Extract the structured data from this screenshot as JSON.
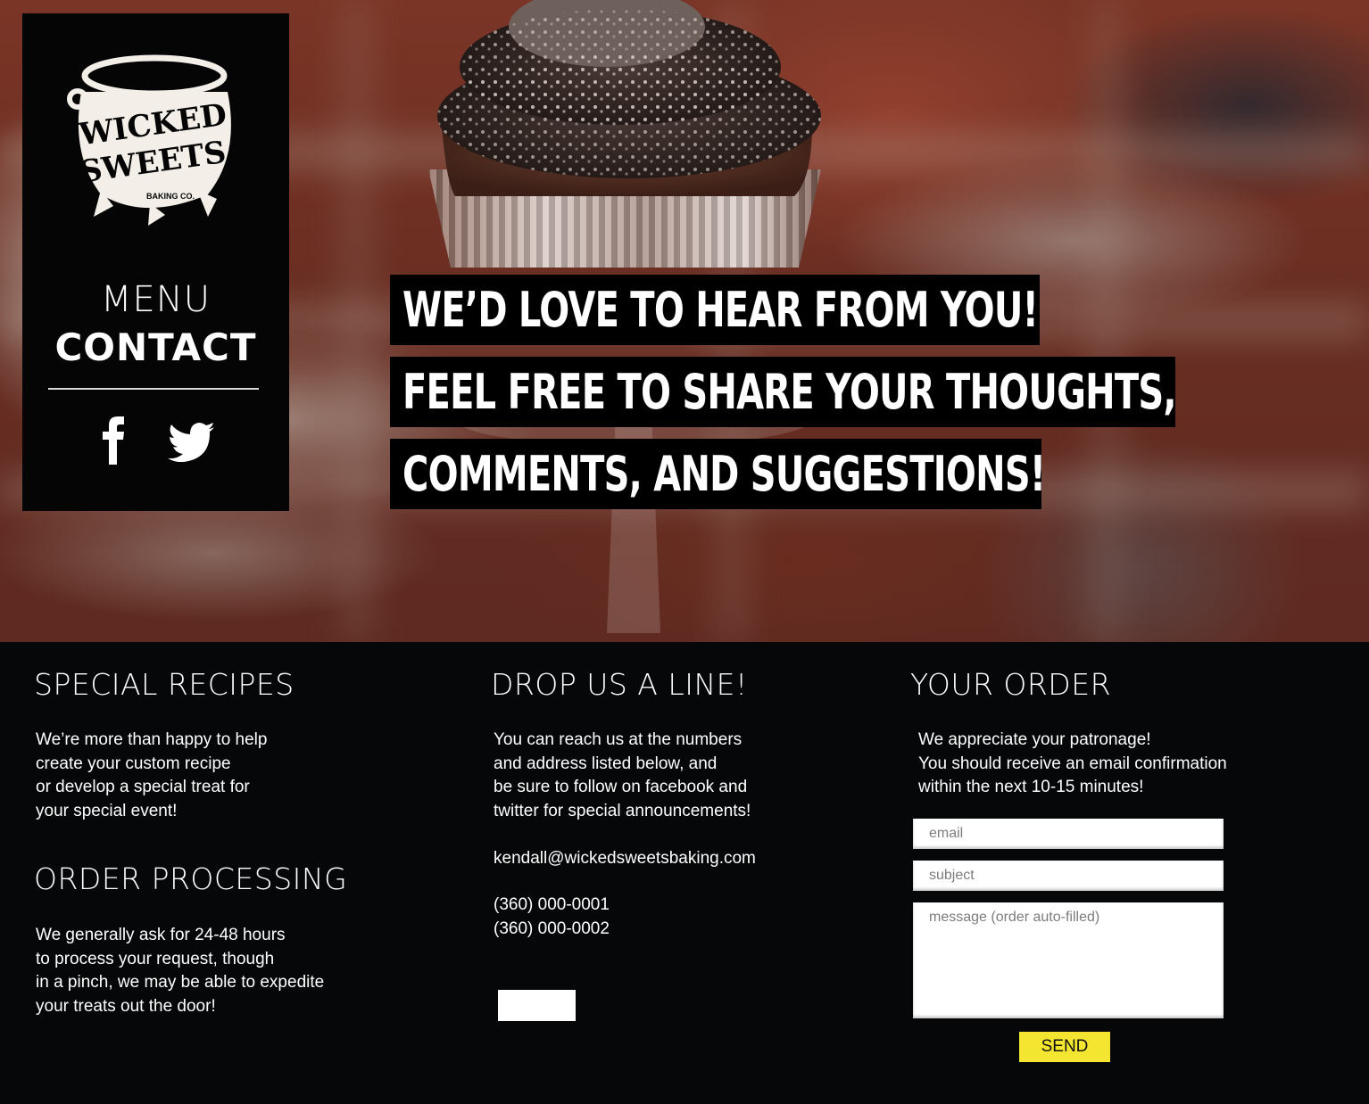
{
  "brand": {
    "logo_line1": "WICKED",
    "logo_line2": "SWEETS",
    "logo_tag": "BAKING CO."
  },
  "nav": {
    "menu_label": "MENU",
    "contact_label": "CONTACT",
    "social": [
      {
        "icon": "facebook-icon"
      },
      {
        "icon": "twitter-icon"
      }
    ]
  },
  "hero": {
    "line1": "WE’D LOVE TO HEAR FROM YOU!",
    "line2": "FEEL FREE TO SHARE YOUR THOUGHTS,",
    "line3": "COMMENTS, AND SUGGESTIONS!"
  },
  "special_recipes": {
    "heading": "SPECIAL RECIPES",
    "text": "We’re more than happy to help\ncreate your custom recipe\nor develop a special treat for\nyour special event!"
  },
  "order_processing": {
    "heading": "ORDER PROCESSING",
    "text": "We generally ask for 24-48 hours\nto process your request, though\nin a pinch, we may be able to expedite\nyour treats out the door!"
  },
  "drop_line": {
    "heading": "DROP US A LINE!",
    "text": "You can reach us at the numbers\nand address listed below, and\nbe sure to follow on facebook and\ntwitter for special announcements!",
    "email": "kendall@wickedsweetsbaking.com",
    "phones": "(360) 000-0001\n(360) 000-0002"
  },
  "your_order": {
    "heading": "YOUR ORDER",
    "text": "We appreciate your patronage!\nYou should receive an email confirmation\nwithin the next 10-15 minutes!",
    "email_placeholder": "email",
    "subject_placeholder": "subject",
    "message_placeholder": "message (order auto-filled)",
    "send_label": "SEND"
  },
  "colors": {
    "panel_bg": "#050505",
    "footer_bg": "#050708",
    "send_button": "#f4e531",
    "text": "#ffffff"
  }
}
